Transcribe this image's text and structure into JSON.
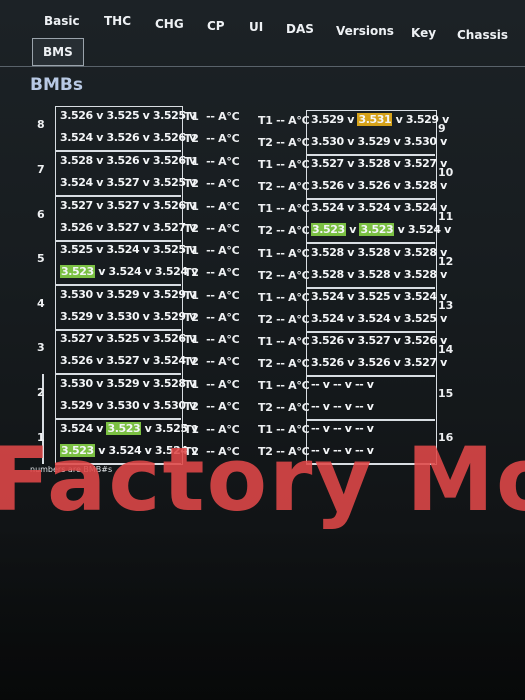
{
  "tabs": [
    "Basic",
    "THC",
    "CHG",
    "CP",
    "UI",
    "DAS",
    "Versions",
    "Key",
    "Chassis"
  ],
  "active_tab": "BMS",
  "section_title": "BMBs",
  "bmbs": [
    {
      "num": "8",
      "rows": [
        [
          "3.526",
          "3.525",
          "3.525"
        ],
        [
          "3.524",
          "3.526",
          "3.526"
        ]
      ],
      "t1": "--",
      "t2": "--",
      "unit": "A°C",
      "hi": []
    },
    {
      "num": "7",
      "rows": [
        [
          "3.528",
          "3.526",
          "3.526"
        ],
        [
          "3.524",
          "3.527",
          "3.525"
        ]
      ],
      "t1": "--",
      "t2": "--",
      "unit": "A°C",
      "hi": []
    },
    {
      "num": "6",
      "rows": [
        [
          "3.527",
          "3.527",
          "3.526"
        ],
        [
          "3.526",
          "3.527",
          "3.527"
        ]
      ],
      "t1": "--",
      "t2": "--",
      "unit": "A°C",
      "hi": []
    },
    {
      "num": "5",
      "rows": [
        [
          "3.525",
          "3.524",
          "3.525"
        ],
        [
          "3.523",
          "3.524",
          "3.524"
        ]
      ],
      "t1": "--",
      "t2": "--",
      "unit": "A°C",
      "hi": [
        [
          1,
          0,
          "g"
        ]
      ]
    },
    {
      "num": "4",
      "rows": [
        [
          "3.530",
          "3.529",
          "3.529"
        ],
        [
          "3.529",
          "3.530",
          "3.529"
        ]
      ],
      "t1": "--",
      "t2": "--",
      "unit": "A°C",
      "hi": []
    },
    {
      "num": "3",
      "rows": [
        [
          "3.527",
          "3.525",
          "3.526"
        ],
        [
          "3.526",
          "3.527",
          "3.524"
        ]
      ],
      "t1": "--",
      "t2": "--",
      "unit": "A°C",
      "hi": []
    },
    {
      "num": "2",
      "rows": [
        [
          "3.530",
          "3.529",
          "3.528"
        ],
        [
          "3.529",
          "3.530",
          "3.530"
        ]
      ],
      "t1": "--",
      "t2": "--",
      "unit": "A°C",
      "hi": []
    },
    {
      "num": "1",
      "rows": [
        [
          "3.524",
          "3.523",
          "3.525"
        ],
        [
          "3.523",
          "3.524",
          "3.524"
        ]
      ],
      "t1": "--",
      "t2": "--",
      "unit": "A°C",
      "hi": [
        [
          0,
          1,
          "g"
        ],
        [
          1,
          0,
          "g"
        ]
      ]
    },
    {
      "num": "9",
      "rows": [
        [
          "3.529",
          "3.531",
          "3.529"
        ],
        [
          "3.530",
          "3.529",
          "3.530"
        ]
      ],
      "t1": "--",
      "t2": "--",
      "unit": "A°C",
      "hi": [
        [
          0,
          1,
          "y"
        ]
      ]
    },
    {
      "num": "10",
      "rows": [
        [
          "3.527",
          "3.528",
          "3.527"
        ],
        [
          "3.526",
          "3.526",
          "3.528"
        ]
      ],
      "t1": "--",
      "t2": "--",
      "unit": "A°C",
      "hi": []
    },
    {
      "num": "11",
      "rows": [
        [
          "3.524",
          "3.524",
          "3.524"
        ],
        [
          "3.523",
          "3.523",
          "3.524"
        ]
      ],
      "t1": "--",
      "t2": "--",
      "unit": "A°C",
      "hi": [
        [
          1,
          0,
          "g"
        ],
        [
          1,
          1,
          "g"
        ]
      ]
    },
    {
      "num": "12",
      "rows": [
        [
          "3.528",
          "3.528",
          "3.528"
        ],
        [
          "3.528",
          "3.528",
          "3.528"
        ]
      ],
      "t1": "--",
      "t2": "--",
      "unit": "A°C",
      "hi": []
    },
    {
      "num": "13",
      "rows": [
        [
          "3.524",
          "3.525",
          "3.524"
        ],
        [
          "3.524",
          "3.524",
          "3.525"
        ]
      ],
      "t1": "--",
      "t2": "--",
      "unit": "A°C",
      "hi": []
    },
    {
      "num": "14",
      "rows": [
        [
          "3.526",
          "3.527",
          "3.526"
        ],
        [
          "3.526",
          "3.526",
          "3.527"
        ]
      ],
      "t1": "--",
      "t2": "--",
      "unit": "A°C",
      "hi": []
    },
    {
      "num": "15",
      "rows": [
        [
          "--",
          "--",
          "--"
        ],
        [
          "--",
          "--",
          "--"
        ]
      ],
      "t1": "--",
      "t2": "--",
      "unit": "A°C",
      "hi": []
    },
    {
      "num": "16",
      "rows": [
        [
          "--",
          "--",
          "--"
        ],
        [
          "--",
          "--",
          "--"
        ]
      ],
      "t1": "--",
      "t2": "--",
      "unit": "A°C",
      "hi": []
    }
  ],
  "volt_unit": "v",
  "t1_label": "T1",
  "t2_label": "T2",
  "footnote": "numbers are BMB#s",
  "watermark": "Factory Mode",
  "colors": {
    "highlight_low": "#7bc043",
    "highlight_high": "#d6a21a",
    "watermark": "#e04848"
  }
}
